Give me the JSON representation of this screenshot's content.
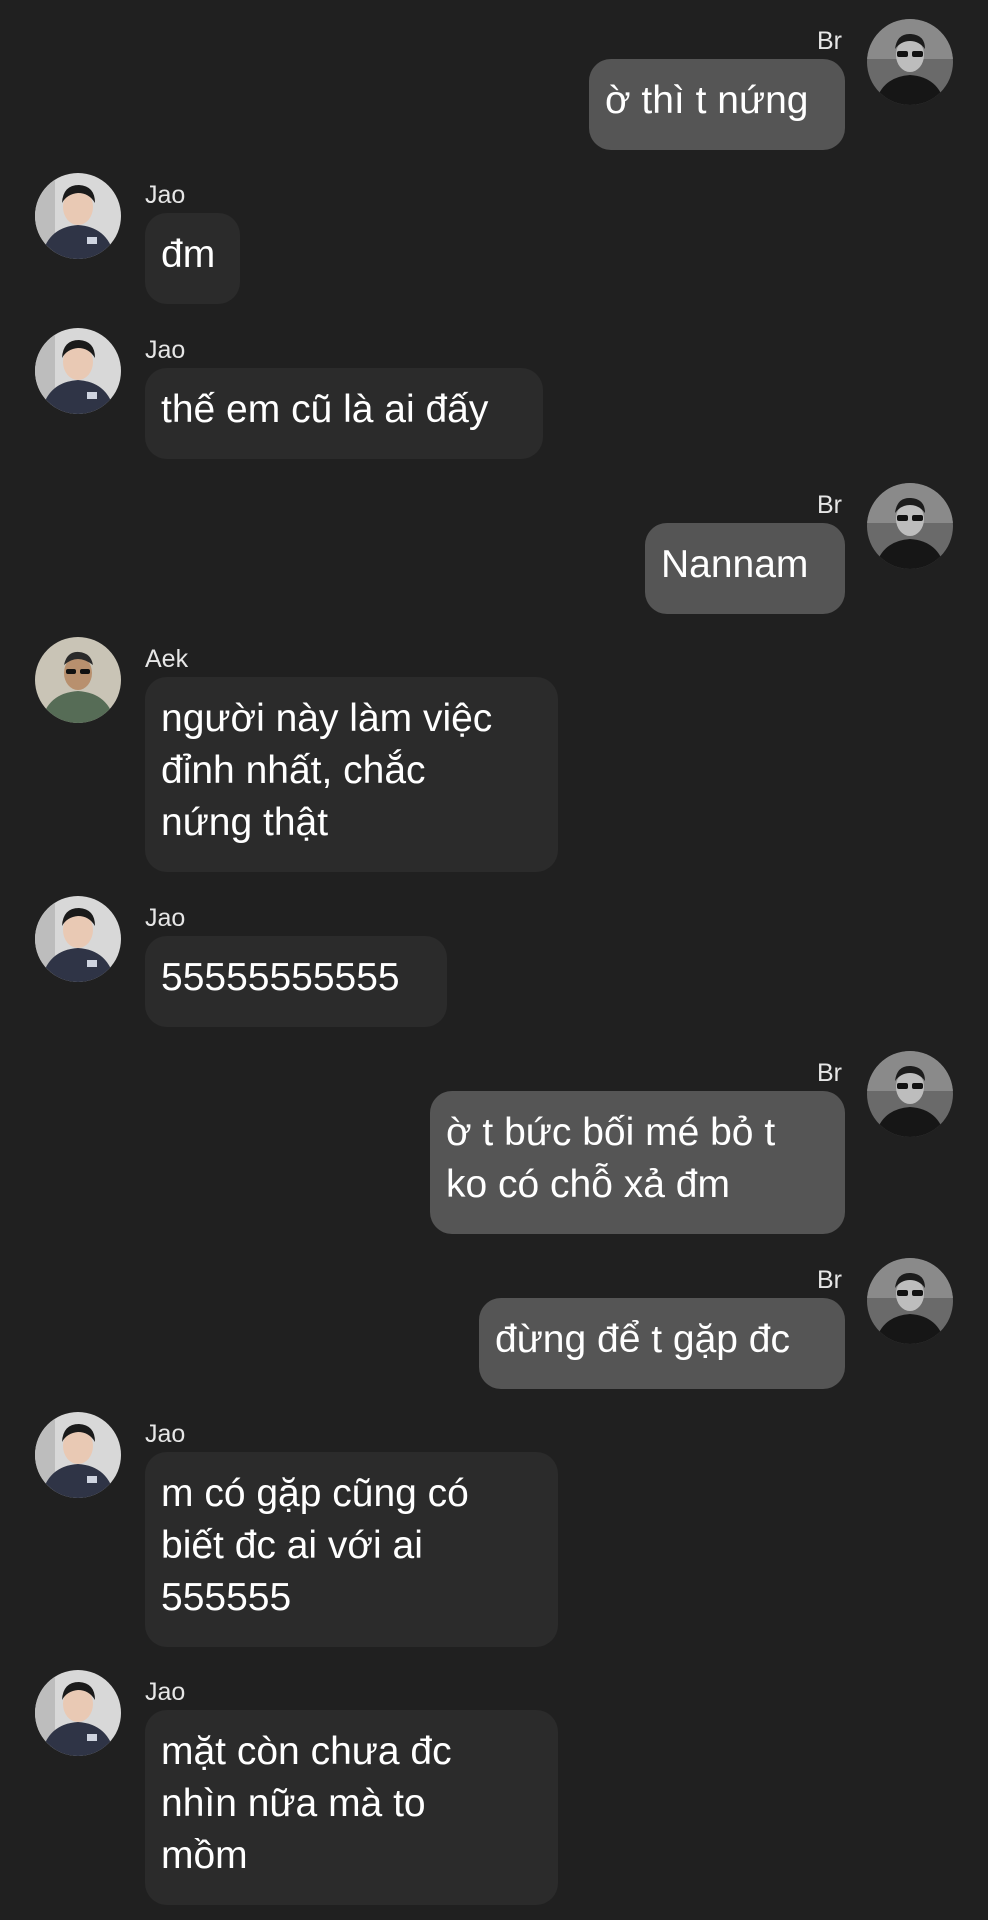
{
  "colors": {
    "background": "#202020",
    "incoming_bubble": "#2b2b2b",
    "outgoing_bubble": "#555555",
    "text": "#ffffff"
  },
  "messages": [
    {
      "sender": "Br",
      "direction": "outgoing",
      "text": "ờ thì t nứng",
      "avatar": "avatar-br-icon"
    },
    {
      "sender": "Jao",
      "direction": "incoming",
      "text": "đm",
      "avatar": "avatar-jao-icon"
    },
    {
      "sender": "Jao",
      "direction": "incoming",
      "text": "thế em cũ là ai đấy",
      "avatar": "avatar-jao-icon"
    },
    {
      "sender": "Br",
      "direction": "outgoing",
      "text": "Nannam",
      "avatar": "avatar-br-icon"
    },
    {
      "sender": "Aek",
      "direction": "incoming",
      "text": "người này làm việc\nđỉnh nhất, chắc\nnứng thật",
      "avatar": "avatar-aek-icon"
    },
    {
      "sender": "Jao",
      "direction": "incoming",
      "text": "55555555555",
      "avatar": "avatar-jao-icon"
    },
    {
      "sender": "Br",
      "direction": "outgoing",
      "text": "ờ t bức bối mé bỏ t\nko có chỗ xả đm",
      "avatar": "avatar-br-icon"
    },
    {
      "sender": "Br",
      "direction": "outgoing",
      "text": "đừng để t gặp đc",
      "avatar": "avatar-br-icon"
    },
    {
      "sender": "Jao",
      "direction": "incoming",
      "text": "m có gặp cũng có\nbiết đc ai với ai\n555555",
      "avatar": "avatar-jao-icon"
    },
    {
      "sender": "Jao",
      "direction": "incoming",
      "text": "mặt còn chưa đc\nnhìn nữa mà to\nmồm",
      "avatar": "avatar-jao-icon"
    }
  ]
}
